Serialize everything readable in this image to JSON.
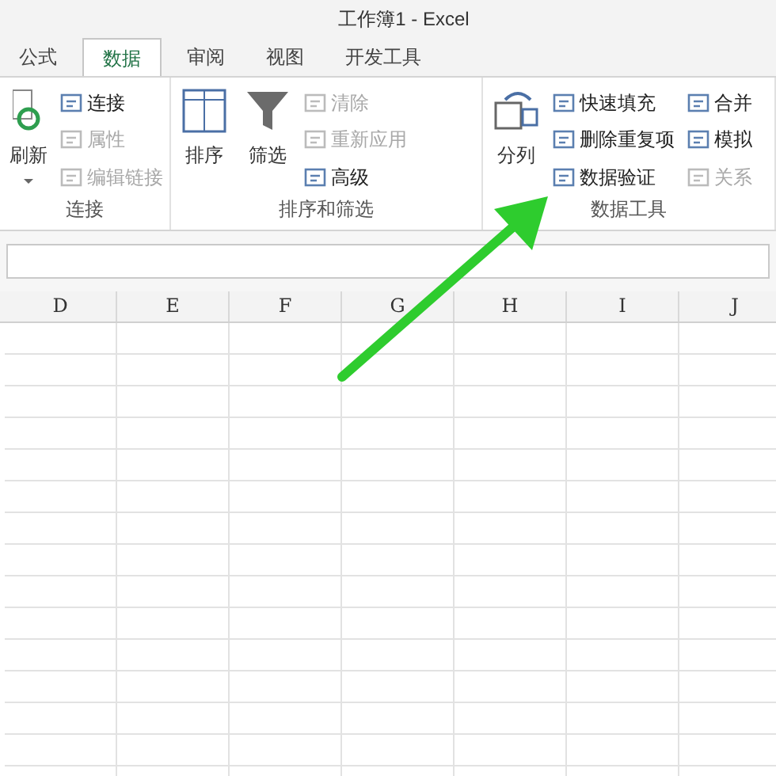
{
  "window": {
    "title": "工作簿1 - Excel"
  },
  "tabs": [
    {
      "label": "公式",
      "selected": false
    },
    {
      "label": "数据",
      "selected": true
    },
    {
      "label": "审阅",
      "selected": false
    },
    {
      "label": "视图",
      "selected": false
    },
    {
      "label": "开发工具",
      "selected": false
    }
  ],
  "groups": [
    {
      "label": "连接",
      "big": [
        {
          "label": "刷新",
          "dropdown": true
        }
      ],
      "small": [
        {
          "label": "连接",
          "disabled": false
        },
        {
          "label": "属性",
          "disabled": true
        },
        {
          "label": "编辑链接",
          "disabled": true
        }
      ]
    },
    {
      "label": "排序和筛选",
      "big": [
        {
          "label": "排序",
          "dropdown": false
        },
        {
          "label": "筛选",
          "dropdown": false
        }
      ],
      "small": [
        {
          "label": "清除",
          "disabled": true
        },
        {
          "label": "重新应用",
          "disabled": true
        },
        {
          "label": "高级",
          "disabled": false
        }
      ]
    },
    {
      "label": "数据工具",
      "big": [
        {
          "label": "分列",
          "dropdown": false
        }
      ],
      "small": [
        {
          "label": "快速填充",
          "disabled": false
        },
        {
          "label": "删除重复项",
          "disabled": false
        },
        {
          "label": "数据验证",
          "disabled": false
        },
        {
          "label": "合并",
          "disabled": false
        },
        {
          "label": "模拟",
          "disabled": false
        },
        {
          "label": "关系",
          "disabled": true
        }
      ]
    }
  ],
  "columns": [
    "D",
    "E",
    "F",
    "G",
    "H",
    "I",
    "J"
  ]
}
